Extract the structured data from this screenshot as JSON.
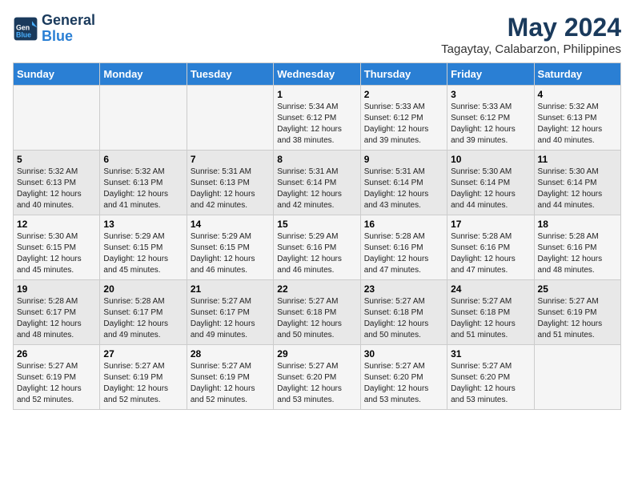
{
  "header": {
    "logo_line1": "General",
    "logo_line2": "Blue",
    "title": "May 2024",
    "subtitle": "Tagaytay, Calabarzon, Philippines"
  },
  "days_of_week": [
    "Sunday",
    "Monday",
    "Tuesday",
    "Wednesday",
    "Thursday",
    "Friday",
    "Saturday"
  ],
  "weeks": [
    [
      {
        "day": "",
        "info": ""
      },
      {
        "day": "",
        "info": ""
      },
      {
        "day": "",
        "info": ""
      },
      {
        "day": "1",
        "info": "Sunrise: 5:34 AM\nSunset: 6:12 PM\nDaylight: 12 hours\nand 38 minutes."
      },
      {
        "day": "2",
        "info": "Sunrise: 5:33 AM\nSunset: 6:12 PM\nDaylight: 12 hours\nand 39 minutes."
      },
      {
        "day": "3",
        "info": "Sunrise: 5:33 AM\nSunset: 6:12 PM\nDaylight: 12 hours\nand 39 minutes."
      },
      {
        "day": "4",
        "info": "Sunrise: 5:32 AM\nSunset: 6:13 PM\nDaylight: 12 hours\nand 40 minutes."
      }
    ],
    [
      {
        "day": "5",
        "info": "Sunrise: 5:32 AM\nSunset: 6:13 PM\nDaylight: 12 hours\nand 40 minutes."
      },
      {
        "day": "6",
        "info": "Sunrise: 5:32 AM\nSunset: 6:13 PM\nDaylight: 12 hours\nand 41 minutes."
      },
      {
        "day": "7",
        "info": "Sunrise: 5:31 AM\nSunset: 6:13 PM\nDaylight: 12 hours\nand 42 minutes."
      },
      {
        "day": "8",
        "info": "Sunrise: 5:31 AM\nSunset: 6:14 PM\nDaylight: 12 hours\nand 42 minutes."
      },
      {
        "day": "9",
        "info": "Sunrise: 5:31 AM\nSunset: 6:14 PM\nDaylight: 12 hours\nand 43 minutes."
      },
      {
        "day": "10",
        "info": "Sunrise: 5:30 AM\nSunset: 6:14 PM\nDaylight: 12 hours\nand 44 minutes."
      },
      {
        "day": "11",
        "info": "Sunrise: 5:30 AM\nSunset: 6:14 PM\nDaylight: 12 hours\nand 44 minutes."
      }
    ],
    [
      {
        "day": "12",
        "info": "Sunrise: 5:30 AM\nSunset: 6:15 PM\nDaylight: 12 hours\nand 45 minutes."
      },
      {
        "day": "13",
        "info": "Sunrise: 5:29 AM\nSunset: 6:15 PM\nDaylight: 12 hours\nand 45 minutes."
      },
      {
        "day": "14",
        "info": "Sunrise: 5:29 AM\nSunset: 6:15 PM\nDaylight: 12 hours\nand 46 minutes."
      },
      {
        "day": "15",
        "info": "Sunrise: 5:29 AM\nSunset: 6:16 PM\nDaylight: 12 hours\nand 46 minutes."
      },
      {
        "day": "16",
        "info": "Sunrise: 5:28 AM\nSunset: 6:16 PM\nDaylight: 12 hours\nand 47 minutes."
      },
      {
        "day": "17",
        "info": "Sunrise: 5:28 AM\nSunset: 6:16 PM\nDaylight: 12 hours\nand 47 minutes."
      },
      {
        "day": "18",
        "info": "Sunrise: 5:28 AM\nSunset: 6:16 PM\nDaylight: 12 hours\nand 48 minutes."
      }
    ],
    [
      {
        "day": "19",
        "info": "Sunrise: 5:28 AM\nSunset: 6:17 PM\nDaylight: 12 hours\nand 48 minutes."
      },
      {
        "day": "20",
        "info": "Sunrise: 5:28 AM\nSunset: 6:17 PM\nDaylight: 12 hours\nand 49 minutes."
      },
      {
        "day": "21",
        "info": "Sunrise: 5:27 AM\nSunset: 6:17 PM\nDaylight: 12 hours\nand 49 minutes."
      },
      {
        "day": "22",
        "info": "Sunrise: 5:27 AM\nSunset: 6:18 PM\nDaylight: 12 hours\nand 50 minutes."
      },
      {
        "day": "23",
        "info": "Sunrise: 5:27 AM\nSunset: 6:18 PM\nDaylight: 12 hours\nand 50 minutes."
      },
      {
        "day": "24",
        "info": "Sunrise: 5:27 AM\nSunset: 6:18 PM\nDaylight: 12 hours\nand 51 minutes."
      },
      {
        "day": "25",
        "info": "Sunrise: 5:27 AM\nSunset: 6:19 PM\nDaylight: 12 hours\nand 51 minutes."
      }
    ],
    [
      {
        "day": "26",
        "info": "Sunrise: 5:27 AM\nSunset: 6:19 PM\nDaylight: 12 hours\nand 52 minutes."
      },
      {
        "day": "27",
        "info": "Sunrise: 5:27 AM\nSunset: 6:19 PM\nDaylight: 12 hours\nand 52 minutes."
      },
      {
        "day": "28",
        "info": "Sunrise: 5:27 AM\nSunset: 6:19 PM\nDaylight: 12 hours\nand 52 minutes."
      },
      {
        "day": "29",
        "info": "Sunrise: 5:27 AM\nSunset: 6:20 PM\nDaylight: 12 hours\nand 53 minutes."
      },
      {
        "day": "30",
        "info": "Sunrise: 5:27 AM\nSunset: 6:20 PM\nDaylight: 12 hours\nand 53 minutes."
      },
      {
        "day": "31",
        "info": "Sunrise: 5:27 AM\nSunset: 6:20 PM\nDaylight: 12 hours\nand 53 minutes."
      },
      {
        "day": "",
        "info": ""
      }
    ]
  ]
}
